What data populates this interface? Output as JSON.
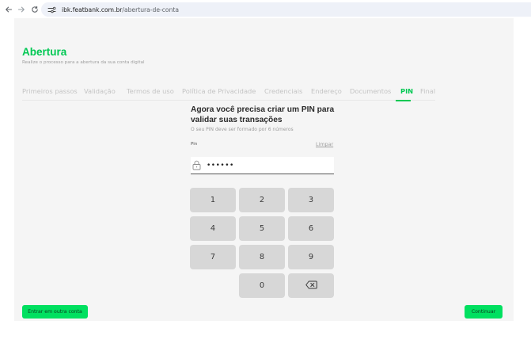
{
  "browser": {
    "url_domain": "ibk.featbank.com.br",
    "url_path": "/abertura-de-conta"
  },
  "page": {
    "title": "Abertura",
    "subtitle": "Realize o processo para a abertura da sua conta digital"
  },
  "steps": [
    {
      "label": "Primeiros passos",
      "active": false
    },
    {
      "label": "Validação",
      "active": false
    },
    {
      "label": "Termos de uso",
      "active": false
    },
    {
      "label": "Política de Privacidade",
      "active": false
    },
    {
      "label": "Credenciais",
      "active": false
    },
    {
      "label": "Endereço",
      "active": false
    },
    {
      "label": "Documentos",
      "active": false
    },
    {
      "label": "PIN",
      "active": true
    },
    {
      "label": "Final",
      "active": false
    }
  ],
  "form": {
    "heading": "Agora você precisa criar um PIN para validar suas transações",
    "hint": "O seu PIN deve ser formado por 6 números",
    "pin_label": "Pin",
    "clear_label": "Limpar",
    "pin_value": "••••••"
  },
  "keypad": {
    "keys": [
      "1",
      "2",
      "3",
      "4",
      "5",
      "6",
      "7",
      "8",
      "9",
      "0"
    ],
    "backspace_icon": "backspace-icon"
  },
  "footer": {
    "switch_account_label": "Entrar em outra conta",
    "continue_label": "Continuar"
  },
  "colors": {
    "accent": "#00c853",
    "button_green": "#00e060",
    "key_bg": "#d7d7d7",
    "panel_bg": "#f5f5f5"
  }
}
